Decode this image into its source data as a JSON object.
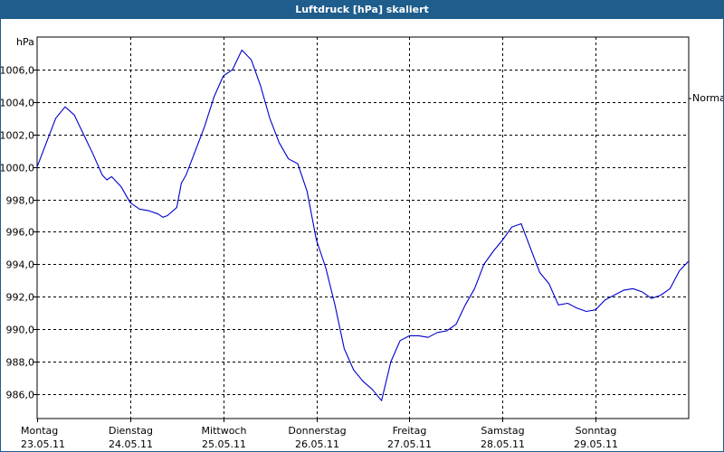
{
  "window": {
    "title": "Luftdruck [hPa] skaliert"
  },
  "chart_data": {
    "type": "line",
    "title": "Luftdruck [hPa] skaliert",
    "ylabel": "hPa",
    "xlabel": "",
    "ylim": [
      984.5,
      1008.0
    ],
    "xlim": [
      0,
      7
    ],
    "grid": true,
    "y_ticks": [
      986.0,
      988.0,
      990.0,
      992.0,
      994.0,
      996.0,
      998.0,
      1000.0,
      1002.0,
      1004.0,
      1006.0
    ],
    "y_tick_labels": [
      "986,0",
      "988,0",
      "990,0",
      "992,0",
      "994,0",
      "996,0",
      "998,0",
      "1000,0",
      "1002,0",
      "1004,0",
      "1006,0"
    ],
    "x_ticks": [
      {
        "day": "Montag",
        "date": "23.05.11"
      },
      {
        "day": "Dienstag",
        "date": "24.05.11"
      },
      {
        "day": "Mittwoch",
        "date": "25.05.11"
      },
      {
        "day": "Donnerstag",
        "date": "26.05.11"
      },
      {
        "day": "Freitag",
        "date": "27.05.11"
      },
      {
        "day": "Samstag",
        "date": "28.05.11"
      },
      {
        "day": "Sonntag",
        "date": "29.05.11"
      }
    ],
    "legend": {
      "label": "Normal",
      "placement": "right"
    },
    "series": [
      {
        "name": "Normal",
        "color": "#0000cc",
        "x": [
          0.0,
          0.1,
          0.2,
          0.3,
          0.4,
          0.5,
          0.6,
          0.7,
          0.75,
          0.8,
          0.9,
          1.0,
          1.1,
          1.2,
          1.3,
          1.35,
          1.4,
          1.5,
          1.55,
          1.6,
          1.7,
          1.8,
          1.9,
          2.0,
          2.1,
          2.2,
          2.3,
          2.4,
          2.5,
          2.6,
          2.7,
          2.8,
          2.9,
          3.0,
          3.1,
          3.2,
          3.3,
          3.4,
          3.5,
          3.6,
          3.7,
          3.8,
          3.9,
          4.0,
          4.1,
          4.2,
          4.3,
          4.4,
          4.5,
          4.6,
          4.7,
          4.8,
          4.9,
          5.0,
          5.1,
          5.2,
          5.3,
          5.4,
          5.5,
          5.6,
          5.7,
          5.8,
          5.9,
          6.0,
          6.1,
          6.2,
          6.3,
          6.4,
          6.5,
          6.6,
          6.7,
          6.8,
          6.9,
          7.0
        ],
        "values": [
          1000.0,
          1001.5,
          1003.0,
          1003.7,
          1003.2,
          1002.0,
          1000.8,
          999.5,
          999.2,
          999.4,
          998.8,
          997.8,
          997.4,
          997.3,
          997.1,
          996.9,
          997.0,
          997.5,
          999.0,
          999.5,
          1001.0,
          1002.5,
          1004.3,
          1005.6,
          1006.0,
          1007.2,
          1006.6,
          1005.0,
          1003.0,
          1001.5,
          1000.5,
          1000.2,
          998.5,
          995.5,
          993.8,
          991.5,
          988.8,
          987.5,
          986.8,
          986.3,
          985.6,
          988.0,
          989.3,
          989.6,
          989.6,
          989.5,
          989.8,
          989.9,
          990.3,
          991.5,
          992.5,
          994.0,
          994.8,
          995.5,
          996.3,
          996.5,
          995.0,
          993.5,
          992.8,
          991.5,
          991.6,
          991.3,
          991.1,
          991.2,
          991.8,
          992.1,
          992.4,
          992.5,
          992.3,
          991.9,
          992.1,
          992.5,
          993.6,
          994.2
        ]
      }
    ]
  }
}
